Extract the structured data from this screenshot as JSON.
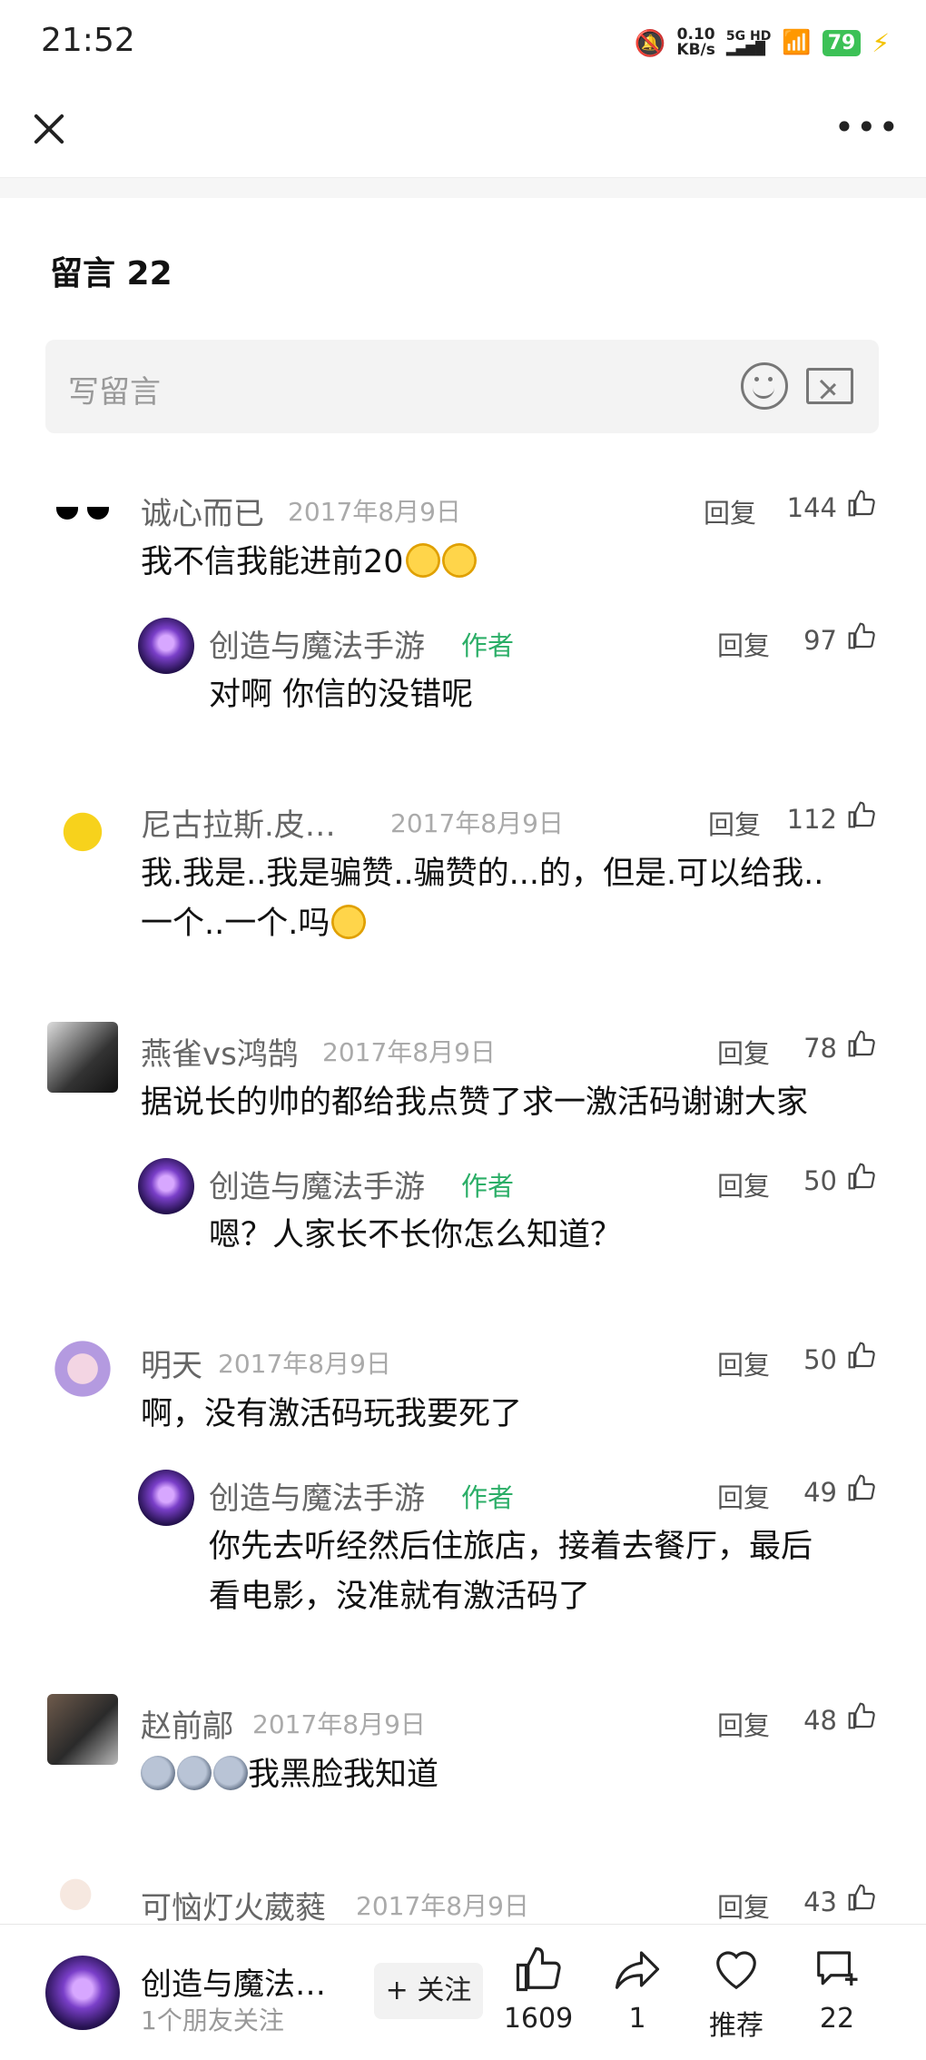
{
  "status": {
    "time": "21:52",
    "net_speed": "0.10",
    "net_unit": "KB/s",
    "signal": "5G HD",
    "battery": "79"
  },
  "header": {
    "close_label": "",
    "more_label": "•••"
  },
  "comments_section": {
    "title": "留言 22",
    "write_placeholder": "写留言",
    "reply_label": "回复",
    "author_tag": "作者",
    "items": [
      {
        "name": "诚心而已",
        "date": "2017年8月9日",
        "likes": "144",
        "text": "我不信我能进前20",
        "reply": {
          "name": "创造与魔法手游",
          "likes": "97",
          "text": "对啊 你信的没错呢"
        }
      },
      {
        "name": "尼古拉斯.皮…",
        "date": "2017年8月9日",
        "likes": "112",
        "text_line1": "我.我是..我是骗赞..骗赞的...的，但是.可以给我..",
        "text_line2": "一个..一个.吗"
      },
      {
        "name": "燕雀vs鸿鹄",
        "date": "2017年8月9日",
        "likes": "78",
        "text": "据说长的帅的都给我点赞了求一激活码谢谢大家",
        "reply": {
          "name": "创造与魔法手游",
          "likes": "50",
          "text": "嗯？人家长不长你怎么知道？"
        }
      },
      {
        "name": "明天",
        "date": "2017年8月9日",
        "likes": "50",
        "text": "啊，没有激活码玩我要死了",
        "reply": {
          "name": "创造与魔法手游",
          "likes": "49",
          "text_line1": "你先去听经然后住旅店，接着去餐厅，最后",
          "text_line2": "看电影，没准就有激活码了"
        }
      },
      {
        "name": "赵前鄗",
        "date": "2017年8月9日",
        "likes": "48",
        "text": "我黑脸我知道"
      },
      {
        "name": "可恼灯火葳蕤",
        "date": "2017年8月9日",
        "likes": "43"
      }
    ]
  },
  "bottom_bar": {
    "account_name": "创造与魔法…",
    "friends_following": "1个朋友关注",
    "follow_label": "+ 关注",
    "like_count": "1609",
    "share_count": "1",
    "recommend_label": "推荐",
    "comment_count": "22"
  }
}
